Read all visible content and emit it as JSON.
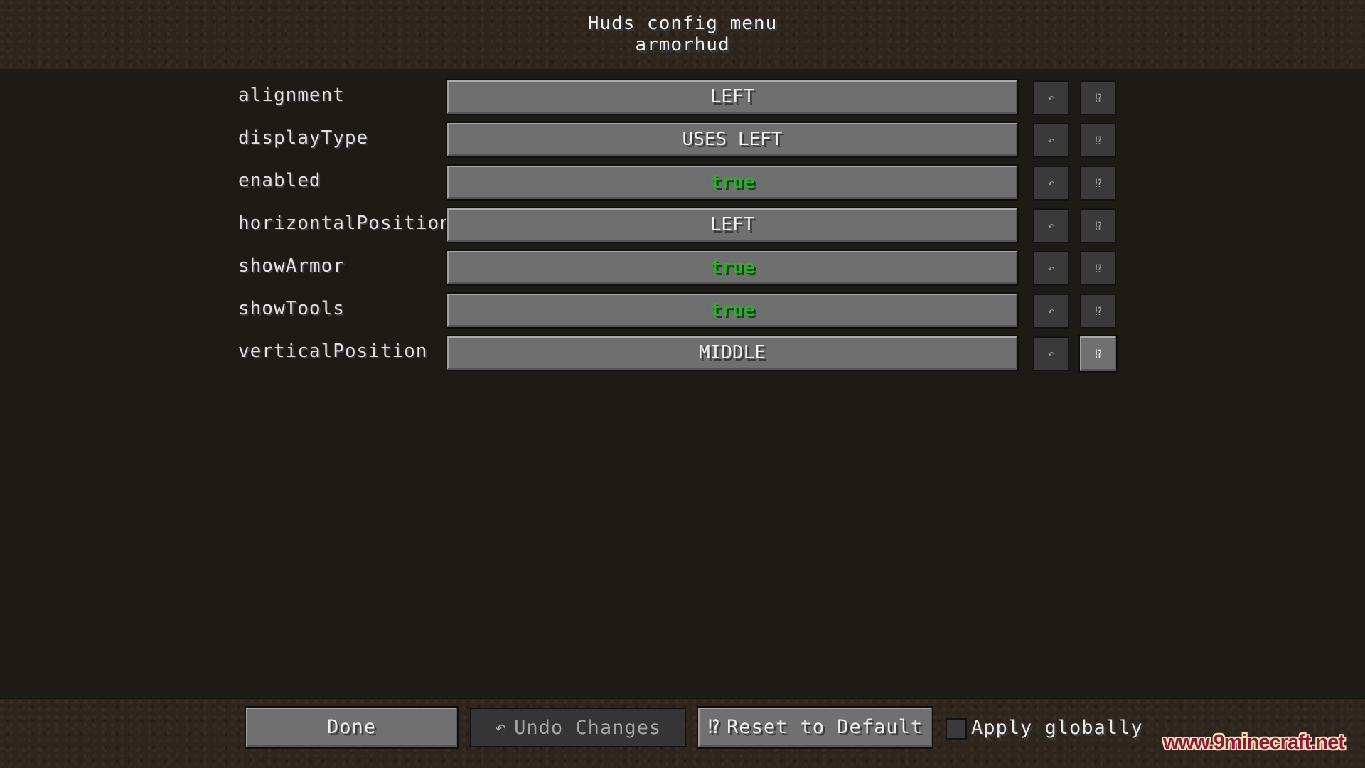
{
  "header": {
    "title": "Huds config menu",
    "subtitle": "armorhud"
  },
  "icons": {
    "undo": "↶",
    "reset": "⁉"
  },
  "options": [
    {
      "name": "alignment",
      "value": "LEFT",
      "value_color": "#efefef",
      "reset_highlighted": false
    },
    {
      "name": "displayType",
      "value": "USES_LEFT",
      "value_color": "#efefef",
      "reset_highlighted": false
    },
    {
      "name": "enabled",
      "value": "true",
      "value_color": "#2cb02c",
      "reset_highlighted": false
    },
    {
      "name": "horizontalPosition",
      "value": "LEFT",
      "value_color": "#efefef",
      "reset_highlighted": false
    },
    {
      "name": "showArmor",
      "value": "true",
      "value_color": "#2cb02c",
      "reset_highlighted": false
    },
    {
      "name": "showTools",
      "value": "true",
      "value_color": "#2cb02c",
      "reset_highlighted": false
    },
    {
      "name": "verticalPosition",
      "value": "MIDDLE",
      "value_color": "#efefef",
      "reset_highlighted": true
    }
  ],
  "footer": {
    "done_label": "Done",
    "undo_label": "Undo Changes",
    "undo_icon": "↶",
    "reset_label": "Reset to Default",
    "reset_icon": "⁉",
    "apply_globally_label": "Apply globally",
    "apply_globally_checked": false
  },
  "watermark": "www.9minecraft.net"
}
